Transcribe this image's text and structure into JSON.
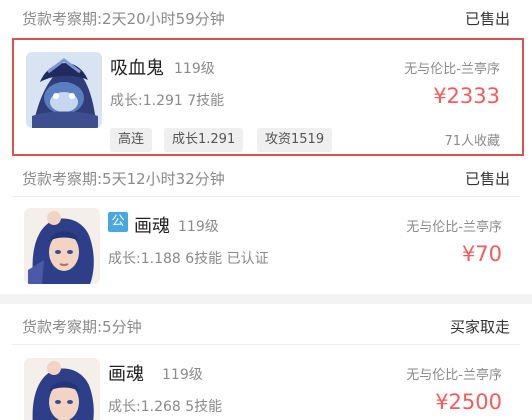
{
  "listings": [
    {
      "period": "货款考察期:2天20小时59分钟",
      "status": "已售出",
      "name": "吸血鬼",
      "level": "119级",
      "server": "无与伦比-兰亭序",
      "growth_line": "成长:1.291 7技能",
      "price": "¥2333",
      "favorites": "71人收藏",
      "tags": [
        "高连",
        "成长1.291",
        "攻资1519"
      ],
      "avatar_icon": "vampire-pet-icon"
    },
    {
      "period": "货款考察期:5天12小时32分钟",
      "status": "已售出",
      "badge": "公",
      "name": "画魂",
      "level": "119级",
      "server": "无与伦比-兰亭序",
      "growth_line": "成长:1.188 6技能 已认证",
      "price": "¥70",
      "avatar_icon": "painted-soul-pet-icon"
    },
    {
      "period": "货款考察期:5分钟",
      "status": "买家取走",
      "name": "画魂",
      "level": "119级",
      "server": "无与伦比-兰亭序",
      "growth_line": "成长:1.268 5技能",
      "price": "¥2500",
      "avatar_icon": "painted-soul-pet-icon"
    }
  ],
  "colors": {
    "price": "#f45b5b",
    "highlight_border": "#d9534f",
    "badge_blue": "#49a8e0",
    "muted_text": "#8a8a8a"
  }
}
